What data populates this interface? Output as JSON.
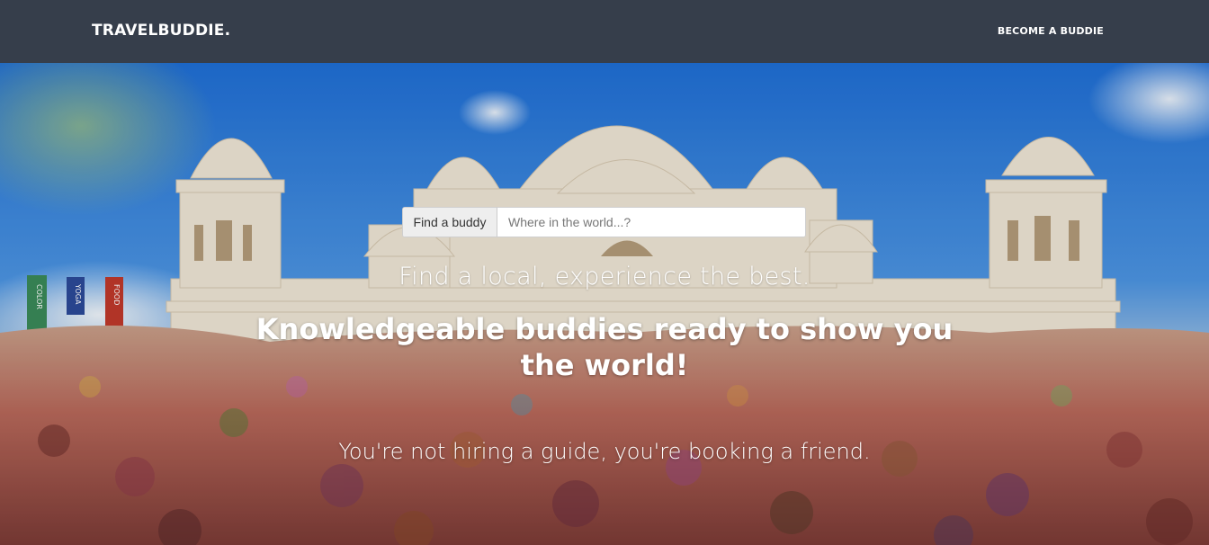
{
  "navbar": {
    "brand": "TRAVELBUDDIE.",
    "become_link": "BECOME A BUDDIE"
  },
  "search": {
    "addon_label": "Find a buddy",
    "placeholder": "Where in the world...?",
    "value": ""
  },
  "hero": {
    "tagline": "Find a local, experience the best.",
    "headline": "Knowledgeable buddies ready to show you the world!",
    "subline": "You're not hiring a guide, you're booking a friend.",
    "banners": [
      "COLOR",
      "YOGA",
      "FOOD"
    ]
  },
  "colors": {
    "navbar_bg": "#363e4b",
    "sky": "#2f78d4",
    "temple": "#efe6d6",
    "banner_green": "#3a8a5a",
    "banner_blue": "#2c4a9a",
    "banner_red": "#c0392b"
  }
}
